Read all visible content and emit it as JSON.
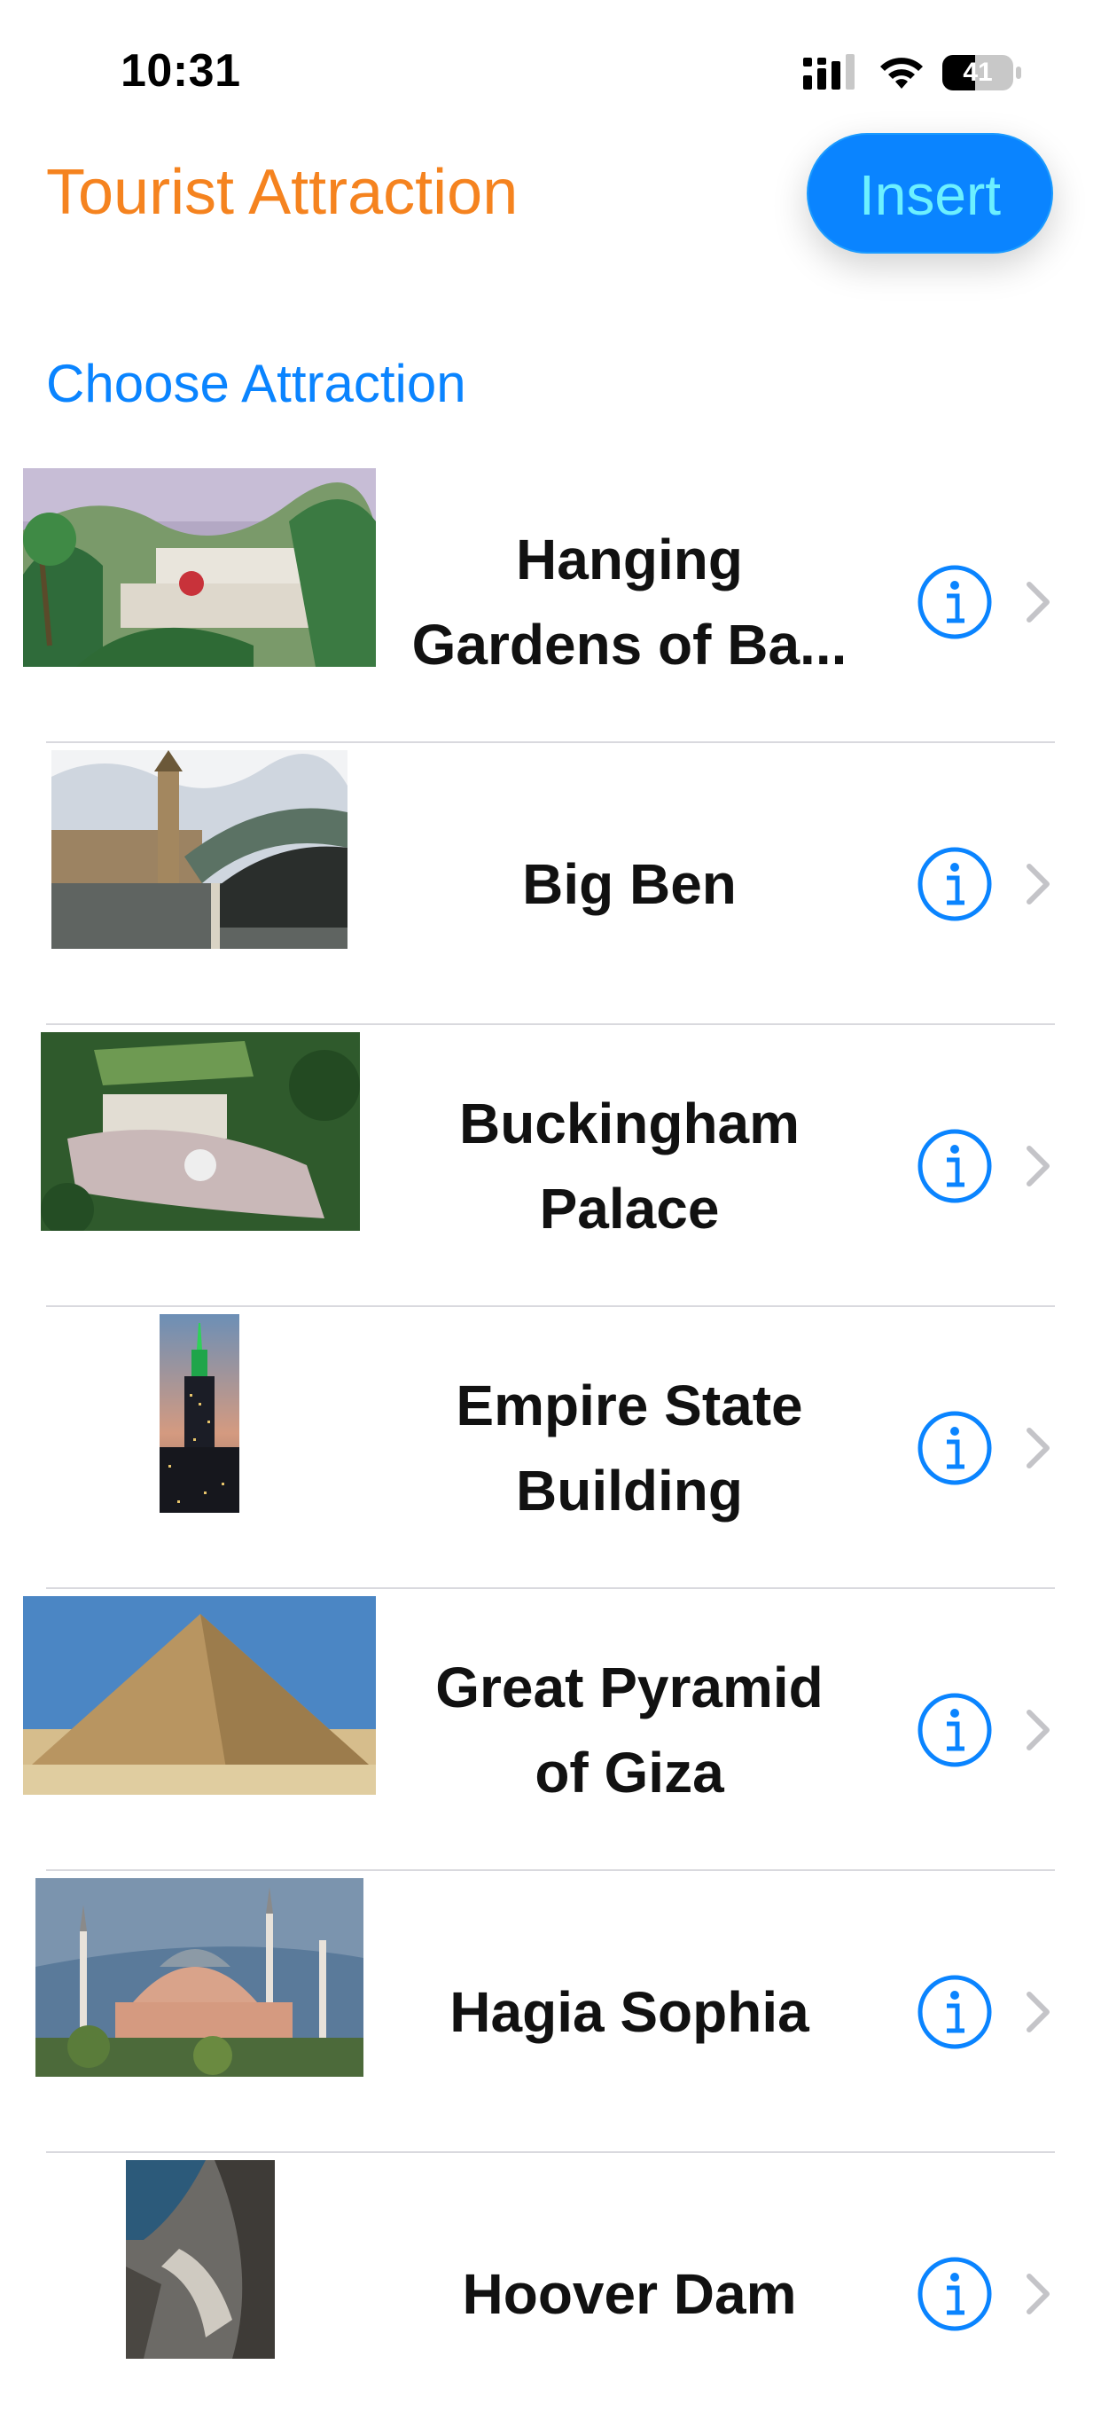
{
  "status_bar": {
    "time": "10:31",
    "battery_level": "41",
    "icons": [
      "cellular-signal-icon",
      "wifi-icon",
      "battery-icon"
    ]
  },
  "header": {
    "title": "Tourist Attraction",
    "insert_label": "Insert"
  },
  "section": {
    "header": "Choose Attraction"
  },
  "attractions": [
    {
      "title_line1": "Hanging",
      "title_line2": "Gardens of Ba..."
    },
    {
      "title_line1": "Big Ben",
      "title_line2": ""
    },
    {
      "title_line1": "Buckingham",
      "title_line2": "Palace"
    },
    {
      "title_line1": "Empire State",
      "title_line2": "Building"
    },
    {
      "title_line1": "Great Pyramid",
      "title_line2": "of Giza"
    },
    {
      "title_line1": "Hagia Sophia",
      "title_line2": ""
    },
    {
      "title_line1": "Hoover Dam",
      "title_line2": ""
    }
  ],
  "colors": {
    "accent_blue": "#0a84ff",
    "title_orange": "#f5831f",
    "divider": "#d9d9de",
    "chevron": "#c4c4c8"
  }
}
